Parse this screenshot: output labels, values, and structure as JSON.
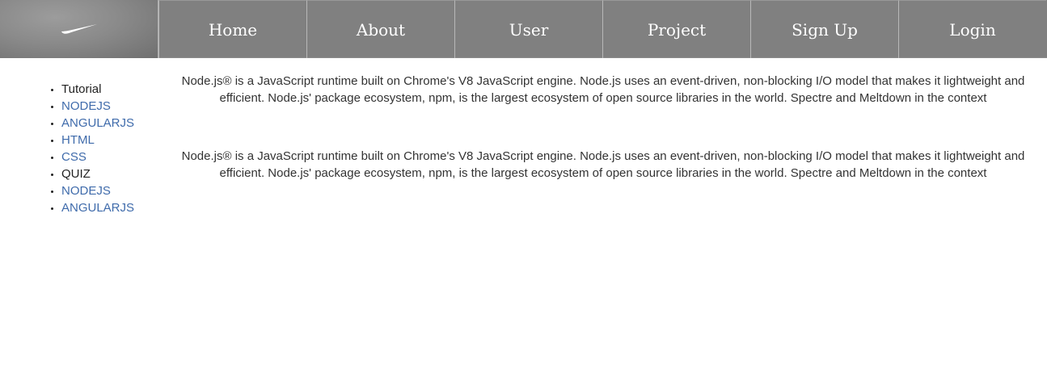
{
  "header": {
    "logo_icon": "swoosh-icon",
    "nav_items": [
      {
        "label": "Home"
      },
      {
        "label": "About"
      },
      {
        "label": "User"
      },
      {
        "label": "Project"
      },
      {
        "label": "Sign Up"
      },
      {
        "label": "Login"
      }
    ]
  },
  "sidebar": {
    "items": [
      {
        "label": "Tutorial",
        "link": false
      },
      {
        "label": "NODEJS",
        "link": true
      },
      {
        "label": "ANGULARJS",
        "link": true
      },
      {
        "label": "HTML",
        "link": true
      },
      {
        "label": "CSS",
        "link": true
      },
      {
        "label": "QUIZ",
        "link": false
      },
      {
        "label": "NODEJS",
        "link": true
      },
      {
        "label": "ANGULARJS",
        "link": true
      }
    ]
  },
  "main": {
    "paragraphs": [
      "Node.js® is a JavaScript runtime built on Chrome's V8 JavaScript engine. Node.js uses an event-driven, non-blocking I/O model that makes it lightweight and efficient. Node.js' package ecosystem, npm, is the largest ecosystem of open source libraries in the world. Spectre and Meltdown in the context",
      "Node.js® is a JavaScript runtime built on Chrome's V8 JavaScript engine. Node.js uses an event-driven, non-blocking I/O model that makes it lightweight and efficient. Node.js' package ecosystem, npm, is the largest ecosystem of open source libraries in the world. Spectre and Meltdown in the context"
    ]
  },
  "colors": {
    "nav_background": "#808080",
    "link": "#3f6bab",
    "text": "#333333"
  }
}
